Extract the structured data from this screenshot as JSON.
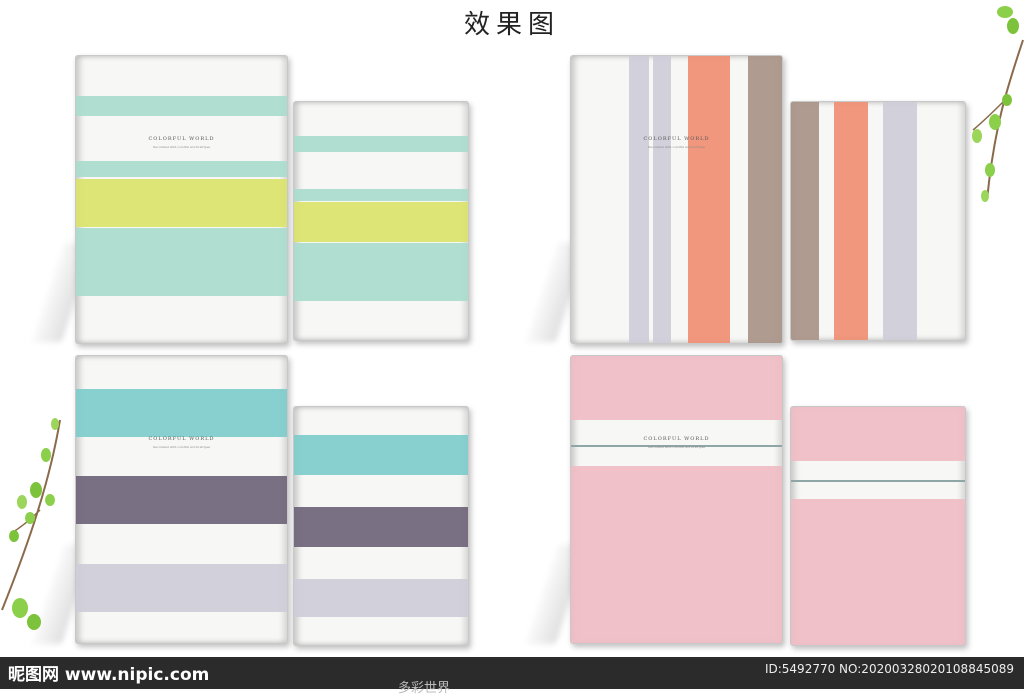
{
  "header": {
    "title": "效果图"
  },
  "cover": {
    "title": "COLORFUL WORLD",
    "subtitle": "Decorated with colorful world stripes"
  },
  "footer": {
    "logo": "昵图网 www.nipic.com",
    "id_text": "ID:5492770 NO:20200328020108845089",
    "caption": "多彩世界"
  },
  "colors": {
    "mint": "#a9dccd",
    "lime": "#dbe36b",
    "teal": "#7dcccb",
    "plum": "#6f6478",
    "lavender": "#cdccd8",
    "salmon": "#ef8e73",
    "taupe": "#a89385",
    "pink": "#f0bcc5",
    "slate": "#8fa6a6"
  }
}
